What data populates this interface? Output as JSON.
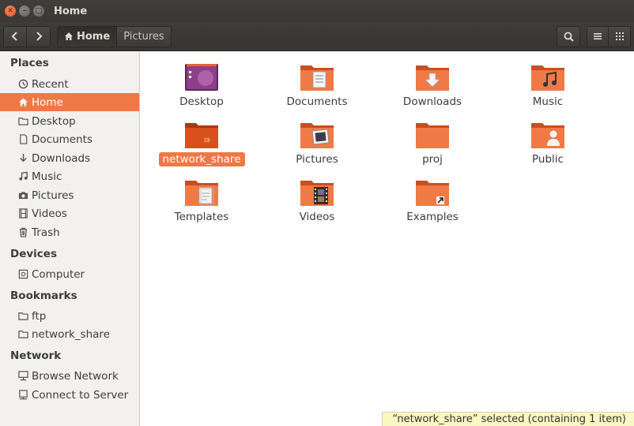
{
  "window": {
    "title": "Home"
  },
  "toolbar": {
    "breadcrumb": [
      {
        "label": "Home",
        "icon": "home-icon"
      },
      {
        "label": "Pictures"
      }
    ]
  },
  "sidebar": {
    "sections": {
      "places": "Places",
      "devices": "Devices",
      "bookmarks": "Bookmarks",
      "network": "Network"
    },
    "places": [
      {
        "label": "Recent",
        "icon": "clock-icon"
      },
      {
        "label": "Home",
        "icon": "home-icon",
        "active": true
      },
      {
        "label": "Desktop",
        "icon": "folder-icon"
      },
      {
        "label": "Documents",
        "icon": "document-icon"
      },
      {
        "label": "Downloads",
        "icon": "download-icon"
      },
      {
        "label": "Music",
        "icon": "music-icon"
      },
      {
        "label": "Pictures",
        "icon": "camera-icon"
      },
      {
        "label": "Videos",
        "icon": "film-icon"
      },
      {
        "label": "Trash",
        "icon": "trash-icon"
      }
    ],
    "devices": [
      {
        "label": "Computer",
        "icon": "computer-icon"
      }
    ],
    "bookmarks": [
      {
        "label": "ftp",
        "icon": "folder-icon"
      },
      {
        "label": "network_share",
        "icon": "folder-icon"
      }
    ],
    "network": [
      {
        "label": "Browse Network",
        "icon": "network-icon"
      },
      {
        "label": "Connect to Server",
        "icon": "server-icon"
      }
    ]
  },
  "files": [
    {
      "label": "Desktop",
      "icon": "desktop-folder-icon"
    },
    {
      "label": "Documents",
      "icon": "documents-folder-icon"
    },
    {
      "label": "Downloads",
      "icon": "downloads-folder-icon"
    },
    {
      "label": "Music",
      "icon": "music-folder-icon"
    },
    {
      "label": "network_share",
      "icon": "network-share-folder-icon",
      "selected": true
    },
    {
      "label": "Pictures",
      "icon": "pictures-folder-icon"
    },
    {
      "label": "proj",
      "icon": "folder-icon"
    },
    {
      "label": "Public",
      "icon": "public-folder-icon"
    },
    {
      "label": "Templates",
      "icon": "templates-folder-icon"
    },
    {
      "label": "Videos",
      "icon": "videos-folder-icon"
    },
    {
      "label": "Examples",
      "icon": "examples-folder-icon"
    }
  ],
  "status": {
    "text": "“network_share” selected  (containing 1 item)"
  },
  "colors": {
    "accent": "#f07746",
    "titlebar": "#3c3b37",
    "sidebar": "#f2f1f0",
    "folder": "#e9622e"
  }
}
